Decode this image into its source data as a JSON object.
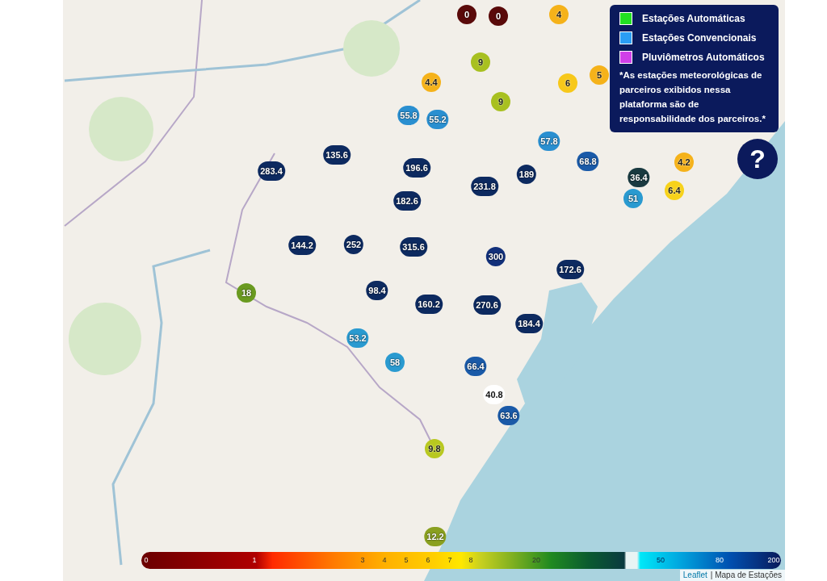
{
  "legend": {
    "items": [
      {
        "label": "Estações Automáticas",
        "color": "#22e022"
      },
      {
        "label": "Estações Convencionais",
        "color": "#2a9df4"
      },
      {
        "label": "Pluviômetros Automáticos",
        "color": "#d040e8"
      }
    ],
    "note": "*As estações meteorológicas de parceiros exibidos nessa plataforma são de responsabilidade dos parceiros.*"
  },
  "help_button": {
    "label": "?"
  },
  "markers": [
    {
      "value": "0",
      "color": "#5a0a0a"
    },
    {
      "value": "0",
      "color": "#5a0a0a"
    },
    {
      "value": "4",
      "color": "#f5b21a"
    },
    {
      "value": "9",
      "color": "#a8c020"
    },
    {
      "value": "4.4",
      "color": "#f5b21a"
    },
    {
      "value": "6",
      "color": "#f7c81a"
    },
    {
      "value": "5",
      "color": "#f5b21a"
    },
    {
      "value": "9",
      "color": "#a8c020"
    },
    {
      "value": "55.8",
      "color": "#2a8fd0"
    },
    {
      "value": "55.2",
      "color": "#2a8fd0"
    },
    {
      "value": "57.8",
      "color": "#2a8fd0"
    },
    {
      "value": "68.8",
      "color": "#1a5aa8"
    },
    {
      "value": "135.6",
      "color": "#0d2a60"
    },
    {
      "value": "196.6",
      "color": "#0d2a60"
    },
    {
      "value": "283.4",
      "color": "#0d2a60"
    },
    {
      "value": "189",
      "color": "#0d2a60"
    },
    {
      "value": "231.8",
      "color": "#0d2a60"
    },
    {
      "value": "36.4",
      "color": "#1a3a40"
    },
    {
      "value": "4.2",
      "color": "#f5b21a"
    },
    {
      "value": "6.4",
      "color": "#f7d21a"
    },
    {
      "value": "51",
      "color": "#2a9ad0"
    },
    {
      "value": "182.6",
      "color": "#0d2a60"
    },
    {
      "value": "144.2",
      "color": "#0d2a60"
    },
    {
      "value": "252",
      "color": "#0d2a60"
    },
    {
      "value": "315.6",
      "color": "#0d2a60"
    },
    {
      "value": "300",
      "color": "#12307a"
    },
    {
      "value": "172.6",
      "color": "#0d2a60"
    },
    {
      "value": "18",
      "color": "#6a9a20"
    },
    {
      "value": "98.4",
      "color": "#0d2a60"
    },
    {
      "value": "160.2",
      "color": "#0d2a60"
    },
    {
      "value": "270.6",
      "color": "#0d2a60"
    },
    {
      "value": "184.4",
      "color": "#0d2a60"
    },
    {
      "value": "53.2",
      "color": "#2a9ad0"
    },
    {
      "value": "58",
      "color": "#2a9ad0"
    },
    {
      "value": "66.4",
      "color": "#1a5aa8"
    },
    {
      "value": "40.8",
      "color": "#ffffff"
    },
    {
      "value": "63.6",
      "color": "#1a5aa8"
    },
    {
      "value": "9.8",
      "color": "#b8c820"
    },
    {
      "value": "12.2",
      "color": "#8aa020"
    }
  ],
  "colorbar": {
    "labels": [
      "0",
      "1",
      "3",
      "4",
      "5",
      "6",
      "7",
      "8",
      "20",
      "50",
      "80",
      "200"
    ]
  },
  "attribution": {
    "link": "Leaflet",
    "text": "| Mapa de Estações"
  }
}
